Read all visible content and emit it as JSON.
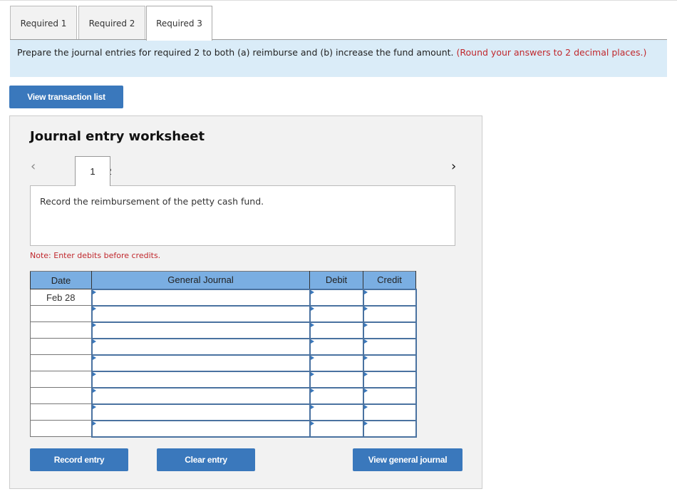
{
  "tabs": [
    {
      "label": "Required 1",
      "active": false
    },
    {
      "label": "Required 2",
      "active": false
    },
    {
      "label": "Required 3",
      "active": true
    }
  ],
  "instructions": {
    "text": "Prepare the journal entries for required 2 to both (a) reimburse and (b) increase the fund amount.",
    "note": "(Round your answers to 2 decimal places.)"
  },
  "view_transaction_list_label": "View transaction list",
  "worksheet": {
    "title": "Journal entry worksheet",
    "pages": [
      "1",
      "2"
    ],
    "current_page": "1",
    "prev_icon": "chevron-left-icon",
    "next_icon": "chevron-right-icon",
    "description": "Record the reimbursement of the petty cash fund.",
    "note": "Note: Enter debits before credits.",
    "table": {
      "headers": [
        "Date",
        "General Journal",
        "Debit",
        "Credit"
      ],
      "rows": [
        {
          "date": "Feb 28",
          "account": "",
          "debit": "",
          "credit": ""
        },
        {
          "date": "",
          "account": "",
          "debit": "",
          "credit": ""
        },
        {
          "date": "",
          "account": "",
          "debit": "",
          "credit": ""
        },
        {
          "date": "",
          "account": "",
          "debit": "",
          "credit": ""
        },
        {
          "date": "",
          "account": "",
          "debit": "",
          "credit": ""
        },
        {
          "date": "",
          "account": "",
          "debit": "",
          "credit": ""
        },
        {
          "date": "",
          "account": "",
          "debit": "",
          "credit": ""
        },
        {
          "date": "",
          "account": "",
          "debit": "",
          "credit": ""
        },
        {
          "date": "",
          "account": "",
          "debit": "",
          "credit": ""
        }
      ]
    },
    "buttons": {
      "record": "Record entry",
      "clear": "Clear entry",
      "view_journal": "View general journal"
    }
  }
}
